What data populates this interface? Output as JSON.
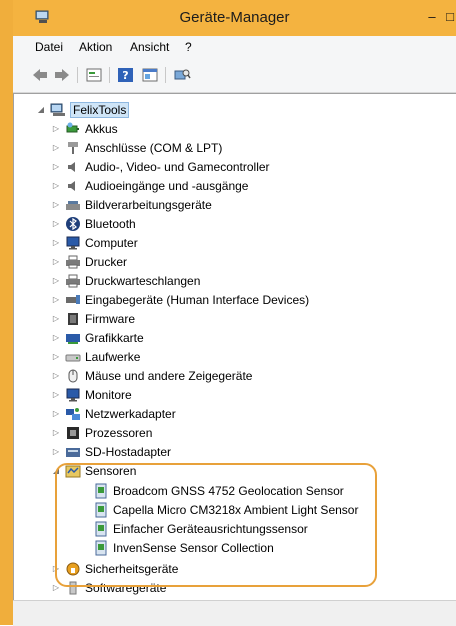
{
  "window": {
    "title": "Geräte-Manager"
  },
  "menu": [
    "Datei",
    "Aktion",
    "Ansicht",
    "?"
  ],
  "toolbar": {
    "icons": [
      "back-icon",
      "forward-icon",
      "properties-icon",
      "help-icon",
      "show-hidden-icon",
      "scan-icon"
    ]
  },
  "tree": {
    "root": "FelixTools",
    "categories": [
      {
        "label": "Akkus",
        "icon": "battery-icon"
      },
      {
        "label": "Anschlüsse (COM & LPT)",
        "icon": "port-icon"
      },
      {
        "label": "Audio-, Video- und Gamecontroller",
        "icon": "speaker-icon"
      },
      {
        "label": "Audioeingänge und -ausgänge",
        "icon": "speaker-icon"
      },
      {
        "label": "Bildverarbeitungsgeräte",
        "icon": "scanner-icon"
      },
      {
        "label": "Bluetooth",
        "icon": "bluetooth-icon"
      },
      {
        "label": "Computer",
        "icon": "monitor-icon"
      },
      {
        "label": "Drucker",
        "icon": "printer-icon"
      },
      {
        "label": "Druckwarteschlangen",
        "icon": "printer-icon"
      },
      {
        "label": "Eingabegeräte (Human Interface Devices)",
        "icon": "hid-icon"
      },
      {
        "label": "Firmware",
        "icon": "firmware-icon"
      },
      {
        "label": "Grafikkarte",
        "icon": "display-adapter-icon"
      },
      {
        "label": "Laufwerke",
        "icon": "drive-icon"
      },
      {
        "label": "Mäuse und andere Zeigegeräte",
        "icon": "mouse-icon"
      },
      {
        "label": "Monitore",
        "icon": "monitor-icon"
      },
      {
        "label": "Netzwerkadapter",
        "icon": "network-icon"
      },
      {
        "label": "Prozessoren",
        "icon": "cpu-icon"
      },
      {
        "label": "SD-Hostadapter",
        "icon": "sd-icon"
      }
    ],
    "expanded": {
      "label": "Sensoren",
      "icon": "sensor-folder-icon",
      "children": [
        "Broadcom GNSS 4752 Geolocation Sensor",
        "Capella Micro CM3218x Ambient Light Sensor",
        "Einfacher Geräteausrichtungssensor",
        "InvenSense Sensor Collection"
      ]
    },
    "after": [
      {
        "label": "Sicherheitsgeräte",
        "icon": "security-icon"
      },
      {
        "label": "Softwaregeräte",
        "icon": "software-icon"
      }
    ]
  },
  "colors": {
    "accent": "#f4b340",
    "highlight": "#e8a13a",
    "selection": "#cfe5f7"
  }
}
